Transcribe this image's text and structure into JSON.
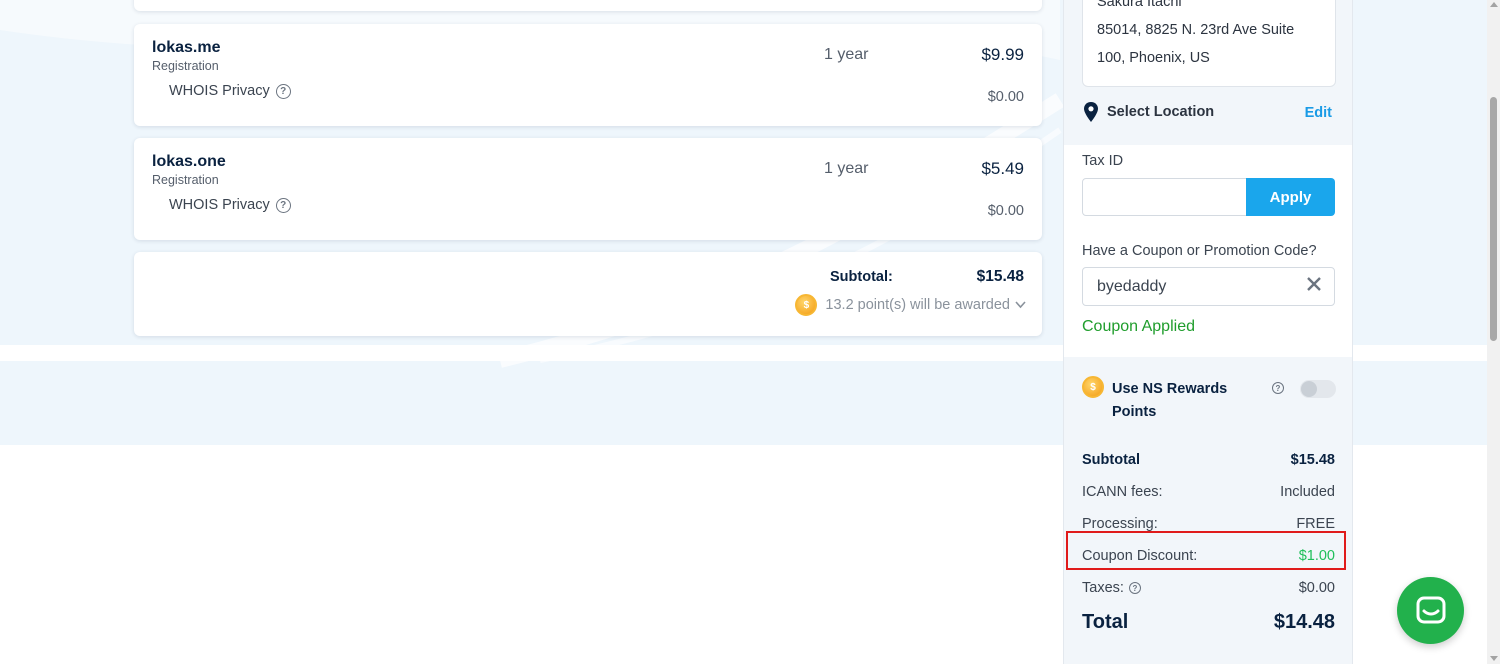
{
  "cart": {
    "items": [
      {
        "domain": "lokas.me",
        "type": "Registration",
        "term": "1 year",
        "price": "$9.99",
        "privacy_label": "WHOIS Privacy",
        "privacy_price": "$0.00"
      },
      {
        "domain": "lokas.one",
        "type": "Registration",
        "term": "1 year",
        "price": "$5.49",
        "privacy_label": "WHOIS Privacy",
        "privacy_price": "$0.00"
      }
    ],
    "subtotal_label": "Subtotal:",
    "subtotal_value": "$15.48",
    "points_text": "13.2 point(s) will be awarded"
  },
  "sidebar": {
    "address": [
      "Sakura Itachi",
      "85014, 8825 N. 23rd Ave Suite",
      "100, Phoenix, US"
    ],
    "select_location": "Select Location",
    "edit": "Edit",
    "tax_id_label": "Tax ID",
    "tax_id_value": "",
    "apply": "Apply",
    "coupon_label": "Have a Coupon or Promotion Code?",
    "coupon_value": "byedaddy",
    "coupon_applied": "Coupon Applied",
    "rewards_label": "Use NS Rewards Points",
    "rewards_enabled": false,
    "summary": {
      "subtotal_label": "Subtotal",
      "subtotal_value": "$15.48",
      "icann_label": "ICANN fees:",
      "icann_value": "Included",
      "processing_label": "Processing:",
      "processing_value": "FREE",
      "coupon_label": "Coupon Discount:",
      "coupon_value": "$1.00",
      "taxes_label": "Taxes:",
      "taxes_value": "$0.00",
      "total_label": "Total",
      "total_value": "$14.48"
    }
  },
  "colors": {
    "accent": "#1aa6ec",
    "success": "#1f9d2c",
    "discount": "#1fbf5a",
    "chat": "#22b14c",
    "highlight": "#e01b1b"
  }
}
